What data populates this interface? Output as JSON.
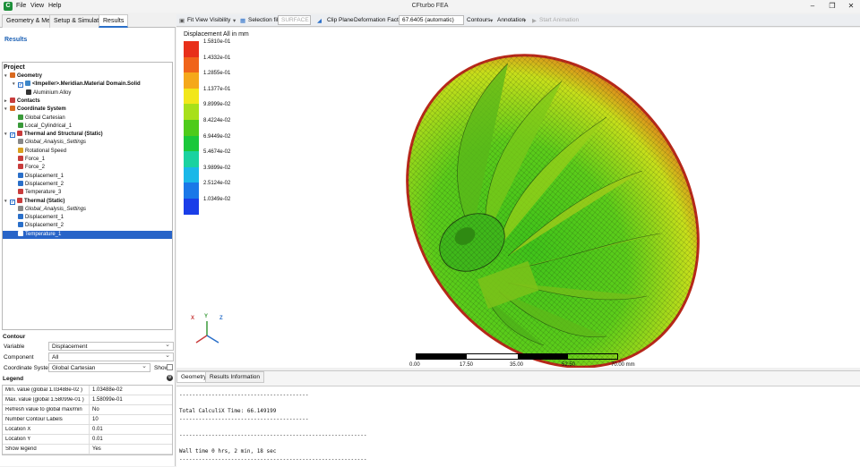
{
  "window": {
    "title": "CFturbo FEA",
    "menu": [
      "File",
      "View",
      "Help"
    ],
    "app_icon": "C"
  },
  "tabs": [
    "Geometry & Mesh",
    "Setup & Simulation",
    "Results"
  ],
  "left": {
    "results_title": "Results",
    "project_title": "Project",
    "tree": [
      {
        "label": "Geometry",
        "bold": true,
        "indent": 0,
        "arrow": "v",
        "icon": "geometry-icon",
        "color": "#d96a1f"
      },
      {
        "label": "<Impeller>.Meridian.Material Domain.Solid",
        "bold": true,
        "indent": 1,
        "arrow": "v",
        "checkbox": true,
        "icon": "solid-icon",
        "color": "#3c86c8"
      },
      {
        "label": "Aluminium Alloy",
        "indent": 2,
        "icon": "material-icon",
        "color": "#333"
      },
      {
        "label": "Contacts",
        "bold": true,
        "indent": 0,
        "arrow": ">",
        "icon": "contacts-icon",
        "color": "#c83c3c"
      },
      {
        "label": "Coordinate System",
        "bold": true,
        "indent": 0,
        "arrow": "v",
        "icon": "coordinate-icon",
        "color": "#d96a1f"
      },
      {
        "label": "Global Cartesian",
        "indent": 1,
        "icon": "axis-icon",
        "color": "#3a9a3a"
      },
      {
        "label": "Local_Cylindrical_1",
        "indent": 1,
        "icon": "axis-icon",
        "color": "#3a9a3a"
      },
      {
        "label": "Thermal and Structural (Static)",
        "bold": true,
        "indent": 0,
        "arrow": "v",
        "checkbox": true,
        "icon": "analysis-icon",
        "color": "#c83c3c"
      },
      {
        "label": "Global_Analysis_Settings",
        "italic": true,
        "indent": 1,
        "icon": "settings-icon",
        "color": "#888"
      },
      {
        "label": "Rotational Speed",
        "indent": 1,
        "icon": "rotation-icon",
        "color": "#d9a01f"
      },
      {
        "label": "Force_1",
        "indent": 1,
        "icon": "force-icon",
        "color": "#c83c3c"
      },
      {
        "label": "Force_2",
        "indent": 1,
        "icon": "force-icon",
        "color": "#c83c3c"
      },
      {
        "label": "Displacement_1",
        "indent": 1,
        "icon": "displacement-icon",
        "color": "#2a6fc9"
      },
      {
        "label": "Displacement_2",
        "indent": 1,
        "icon": "displacement-icon",
        "color": "#2a6fc9"
      },
      {
        "label": "Temperature_3",
        "indent": 1,
        "icon": "temperature-icon",
        "color": "#c83c3c"
      },
      {
        "label": "Thermal (Static)",
        "bold": true,
        "indent": 0,
        "arrow": "v",
        "checkbox": true,
        "icon": "analysis-icon",
        "color": "#c83c3c"
      },
      {
        "label": "Global_Analysis_Settings",
        "italic": true,
        "indent": 1,
        "icon": "settings-icon",
        "color": "#888"
      },
      {
        "label": "Displacement_1",
        "indent": 1,
        "icon": "displacement-icon",
        "color": "#2a6fc9"
      },
      {
        "label": "Displacement_2",
        "indent": 1,
        "icon": "displacement-icon",
        "color": "#2a6fc9"
      },
      {
        "label": "Temperature_1",
        "indent": 1,
        "icon": "temperature-icon",
        "color": "#c83c3c",
        "selected": true
      }
    ],
    "contour": {
      "title": "Contour",
      "variable_label": "Variable",
      "variable_value": "Displacement",
      "component_label": "Component",
      "component_value": "All",
      "coord_label": "Coordinate System",
      "coord_value": "Global Cartesian",
      "show_label": "Show"
    },
    "legend": {
      "title": "Legend",
      "rows": [
        {
          "k": "Min. value (global 1.03488e-02 )",
          "v": "1.03488e-02"
        },
        {
          "k": "Max. value (global 1.58099e-01 )",
          "v": "1.58099e-01"
        },
        {
          "k": "Refresh value to global max/min",
          "v": "No"
        },
        {
          "k": "Number Contour Labels",
          "v": "10"
        },
        {
          "k": "Location X",
          "v": "0.01"
        },
        {
          "k": "Location Y",
          "v": "0.01"
        },
        {
          "k": "Show legend",
          "v": "Yes"
        }
      ]
    }
  },
  "toolbar": {
    "fit_view": "Fit View",
    "visibility": "Visibility",
    "selection_filter": "Selection filter",
    "selection_value": "SURFACE",
    "clip_plane": "Clip Plane",
    "deformation_factor": "Deformation Factor",
    "deformation_value": "67.6405 (automatic)",
    "contours": "Contours",
    "annotation": "Annotation",
    "start_animation": "Start Animation"
  },
  "colorbar": {
    "title": "Displacement All in mm",
    "labels": [
      "1.5810e-01",
      "1.4332e-01",
      "1.2855e-01",
      "1.1377e-01",
      "9.8999e-02",
      "8.4224e-02",
      "6.9449e-02",
      "5.4674e-02",
      "3.9899e-02",
      "2.5124e-02",
      "1.0349e-02"
    ],
    "colors": [
      "#e8301a",
      "#f0641a",
      "#f5a81a",
      "#f2e71a",
      "#a8e01a",
      "#4ecb1a",
      "#1ac83a",
      "#1ad2a0",
      "#1ab8e8",
      "#1a78e8",
      "#1a3ee8"
    ]
  },
  "scale_bar": {
    "ticks": [
      "0.00",
      "17.50",
      "35.00",
      "52.50",
      "70.00 mm"
    ]
  },
  "axes": {
    "x": "X",
    "y": "Y",
    "z": "Z"
  },
  "bottom": {
    "tabs": [
      "Geometry",
      "Results Information"
    ],
    "log": [
      "----------------------------------------",
      "",
      "Total CalculiX Time: 66.149199",
      "----------------------------------------",
      "",
      "----------------------------------------------------------",
      "",
      "Wall time 0 hrs, 2 min, 18 sec",
      "----------------------------------------------------------"
    ]
  }
}
